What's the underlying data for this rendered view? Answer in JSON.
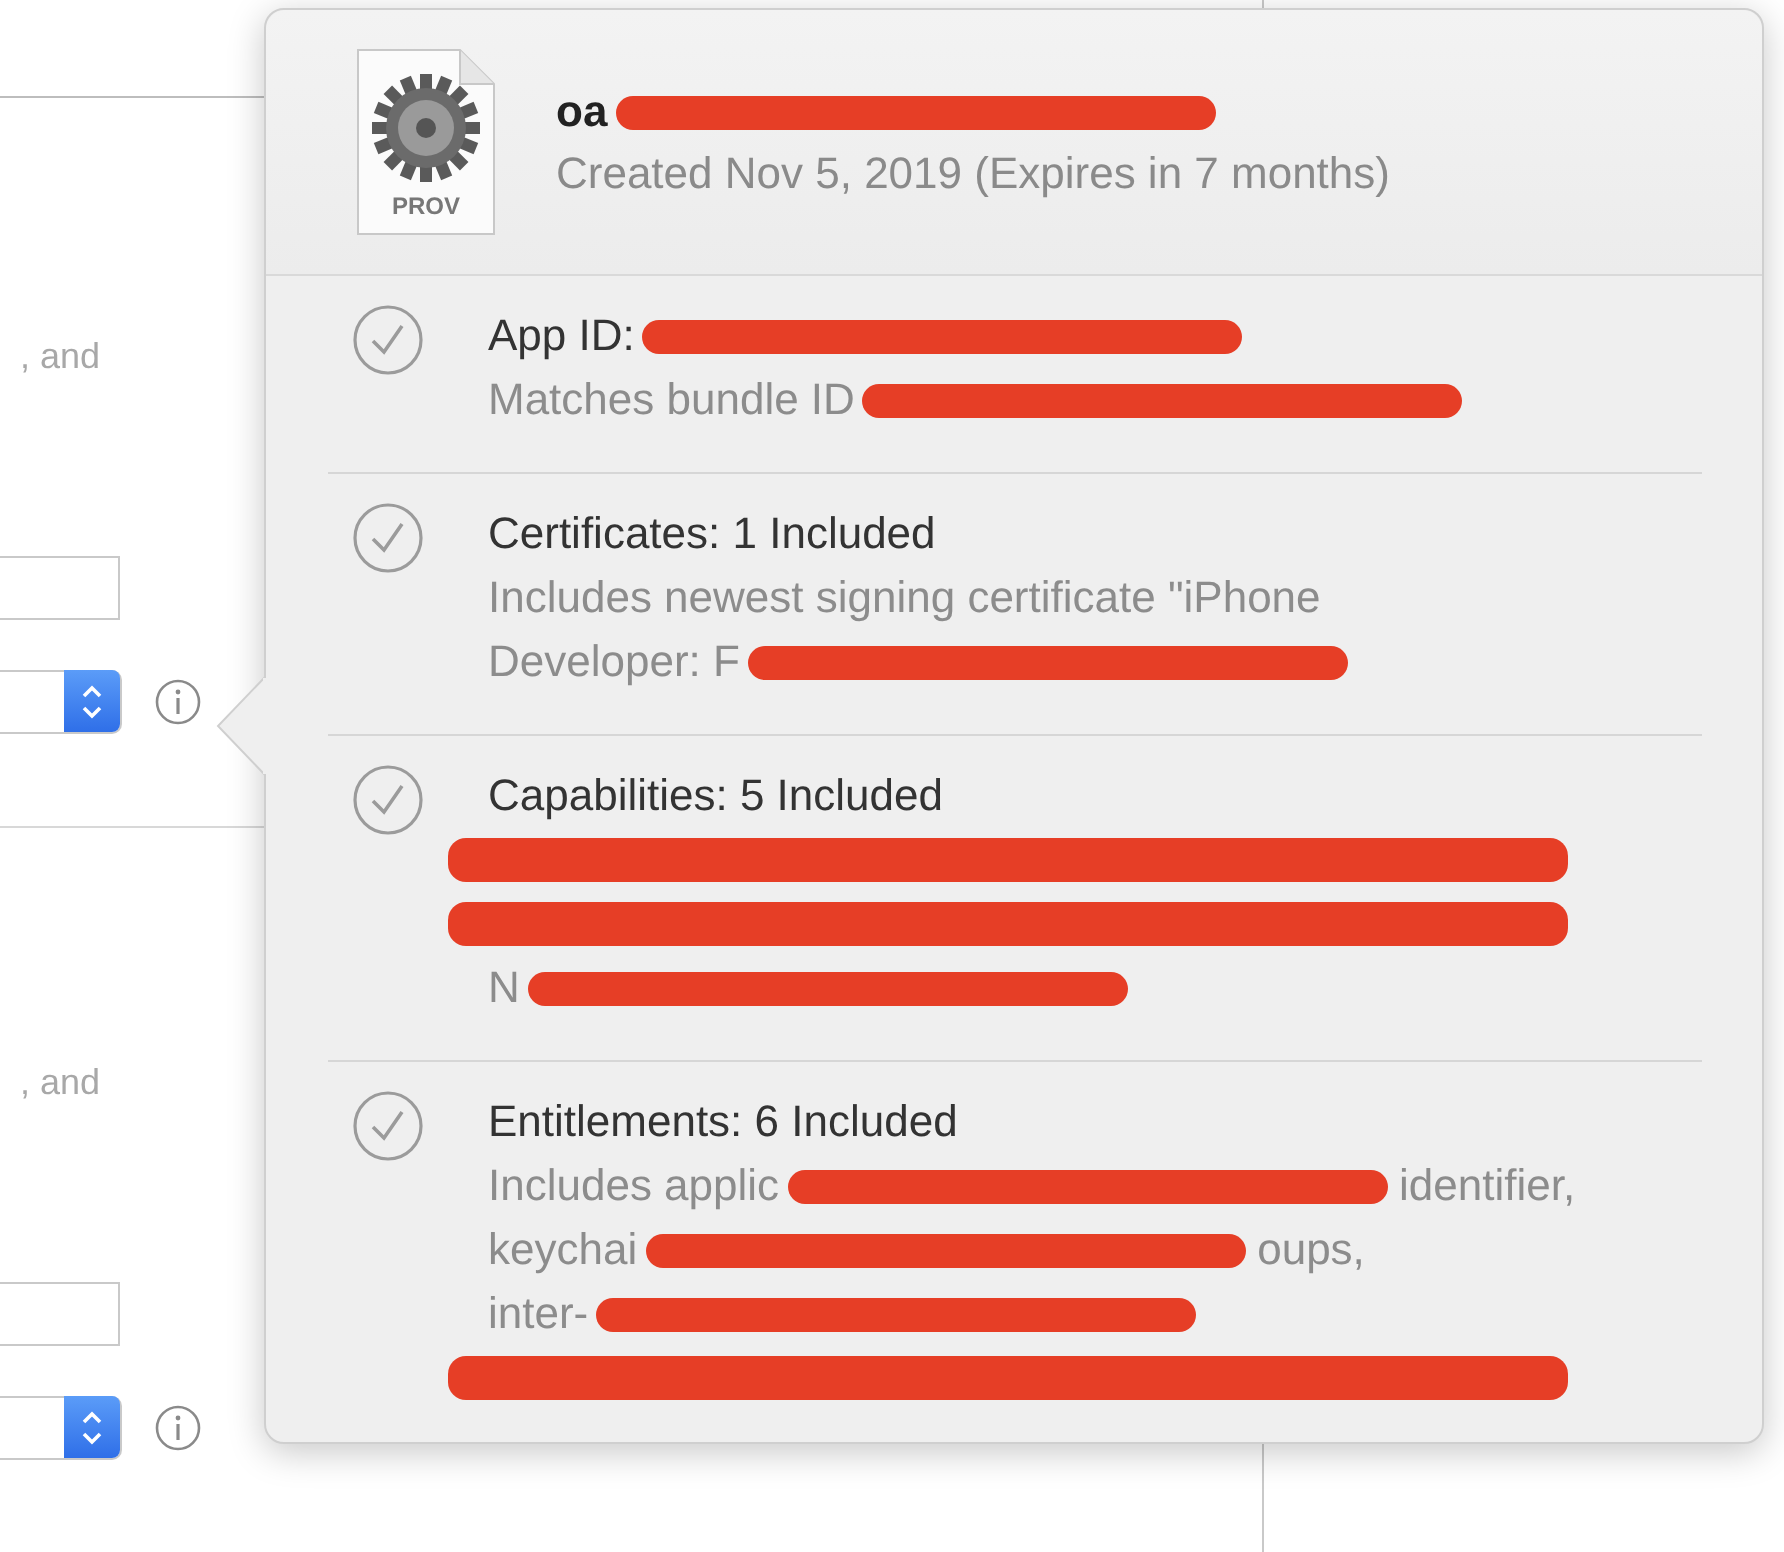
{
  "settings_panel": {
    "groups": [
      {
        "note": ", and",
        "field": {
          "kind": "text"
        },
        "popup": {
          "kind": "stepper"
        }
      },
      {
        "note": ", and",
        "field": {
          "kind": "text"
        },
        "popup": {
          "kind": "stepper"
        }
      }
    ]
  },
  "popover": {
    "header": {
      "file_type": "PROV",
      "title": {
        "text": "oa",
        "kind": "partly_covered"
      },
      "subtitle": "Created Nov 5, 2019 (Expires in 7 months)"
    },
    "rows": [
      {
        "checked": true,
        "title": {
          "text": "App ID:",
          "kind": "partly_covered"
        },
        "lines": [
          {
            "text": "Matches bundle ID",
            "kind": "partly_covered"
          }
        ]
      },
      {
        "checked": true,
        "title": {
          "text": "Certificates: 1 Included",
          "kind": "text"
        },
        "lines": [
          {
            "text": "Includes newest signing certificate \"iPhone",
            "kind": "text"
          },
          {
            "text": "Developer: F",
            "kind": "partly_covered"
          }
        ]
      },
      {
        "checked": true,
        "title": {
          "text": "Capabilities: 5 Included",
          "kind": "text"
        },
        "lines": [
          {
            "kind": "covered"
          },
          {
            "kind": "covered"
          },
          {
            "text": "N",
            "kind": "partly_covered"
          }
        ]
      },
      {
        "checked": true,
        "title": {
          "text": "Entitlements: 6 Included",
          "kind": "text"
        },
        "lines": [
          {
            "text": "Includes applic",
            "kind": "partly_covered",
            "tail": "identifier,"
          },
          {
            "text": "keychai",
            "kind": "partly_covered",
            "tail": "oups,"
          },
          {
            "text": "inter-",
            "kind": "partly_covered"
          },
          {
            "kind": "covered"
          }
        ]
      }
    ]
  }
}
